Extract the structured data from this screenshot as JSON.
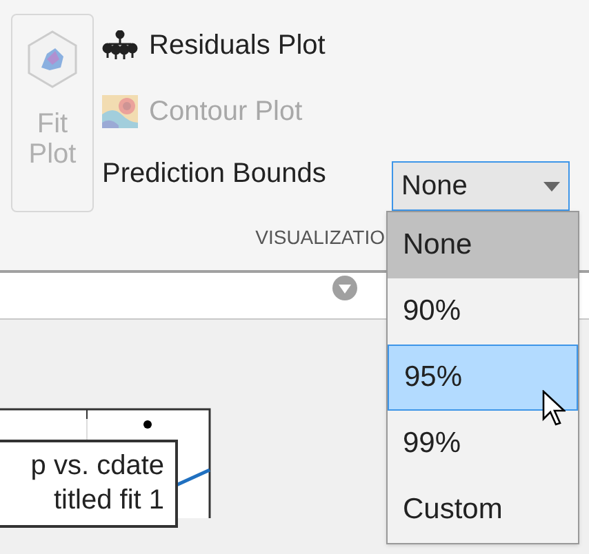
{
  "ribbon": {
    "fit_plot": {
      "label_lines": [
        "Fit",
        "Plot"
      ],
      "disabled": true
    },
    "buttons": [
      {
        "kind": "residuals",
        "label": "Residuals Plot",
        "disabled": false
      },
      {
        "kind": "contour",
        "label": "Contour Plot",
        "disabled": true
      }
    ],
    "prediction_bounds": {
      "label": "Prediction Bounds",
      "value": "None"
    },
    "section_label": "VISUALIZATIO"
  },
  "dropdown_menu": [
    {
      "label": "None",
      "selected": true,
      "hovered": false
    },
    {
      "label": "90%",
      "selected": false,
      "hovered": false
    },
    {
      "label": "95%",
      "selected": false,
      "hovered": true
    },
    {
      "label": "99%",
      "selected": false,
      "hovered": false
    },
    {
      "label": "Custom",
      "selected": false,
      "hovered": false
    }
  ],
  "plot": {
    "legend": [
      "p vs. cdate",
      "titled fit 1"
    ]
  }
}
